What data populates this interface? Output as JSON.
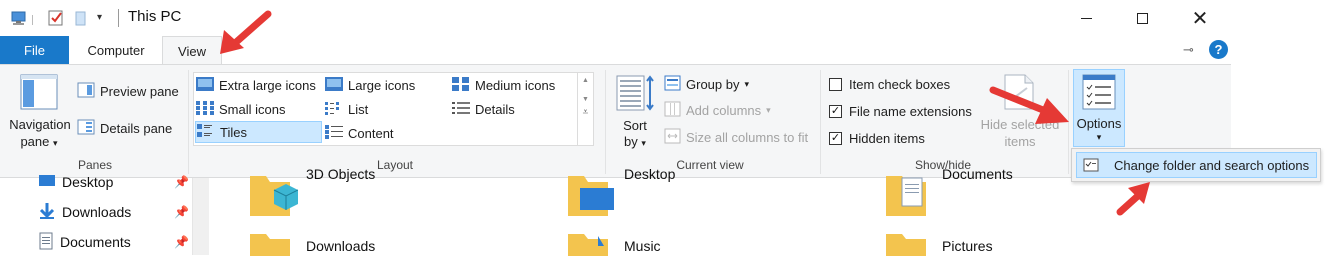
{
  "window": {
    "title": "This PC",
    "minimize_icon": "minimize-icon",
    "maximize_icon": "maximize-icon",
    "close_icon": "close-icon"
  },
  "ribbon_tabs": {
    "file": "File",
    "computer": "Computer",
    "view": "View"
  },
  "panes_group": {
    "label": "Panes",
    "navigation_pane_line1": "Navigation",
    "navigation_pane_line2": "pane",
    "preview_pane": "Preview pane",
    "details_pane": "Details pane"
  },
  "layout_group": {
    "label": "Layout",
    "items": [
      "Extra large icons",
      "Large icons",
      "Medium icons",
      "Small icons",
      "List",
      "Details",
      "Tiles",
      "Content"
    ],
    "selected": "Tiles"
  },
  "current_view_group": {
    "label": "Current view",
    "sort_by_line1": "Sort",
    "sort_by_line2": "by",
    "group_by": "Group by",
    "add_columns": "Add columns",
    "size_all_columns": "Size all columns to fit"
  },
  "show_hide_group": {
    "label": "Show/hide",
    "item_check_boxes": "Item check boxes",
    "file_name_extensions": "File name extensions",
    "hidden_items": "Hidden items",
    "hide_selected_line1": "Hide selected",
    "hide_selected_line2": "items",
    "checkboxes": {
      "item_check_boxes": false,
      "file_name_extensions": true,
      "hidden_items": true
    }
  },
  "options": {
    "label": "Options",
    "menu_item": "Change folder and search options"
  },
  "nav_pane": {
    "items": [
      "Desktop",
      "Downloads",
      "Documents"
    ]
  },
  "content": {
    "folders": [
      "3D Objects",
      "Desktop",
      "Documents",
      "Downloads",
      "Music",
      "Pictures"
    ]
  },
  "colors": {
    "accent": "#1979ca",
    "selection": "#cce8ff",
    "annotation_arrow": "#e53935"
  }
}
